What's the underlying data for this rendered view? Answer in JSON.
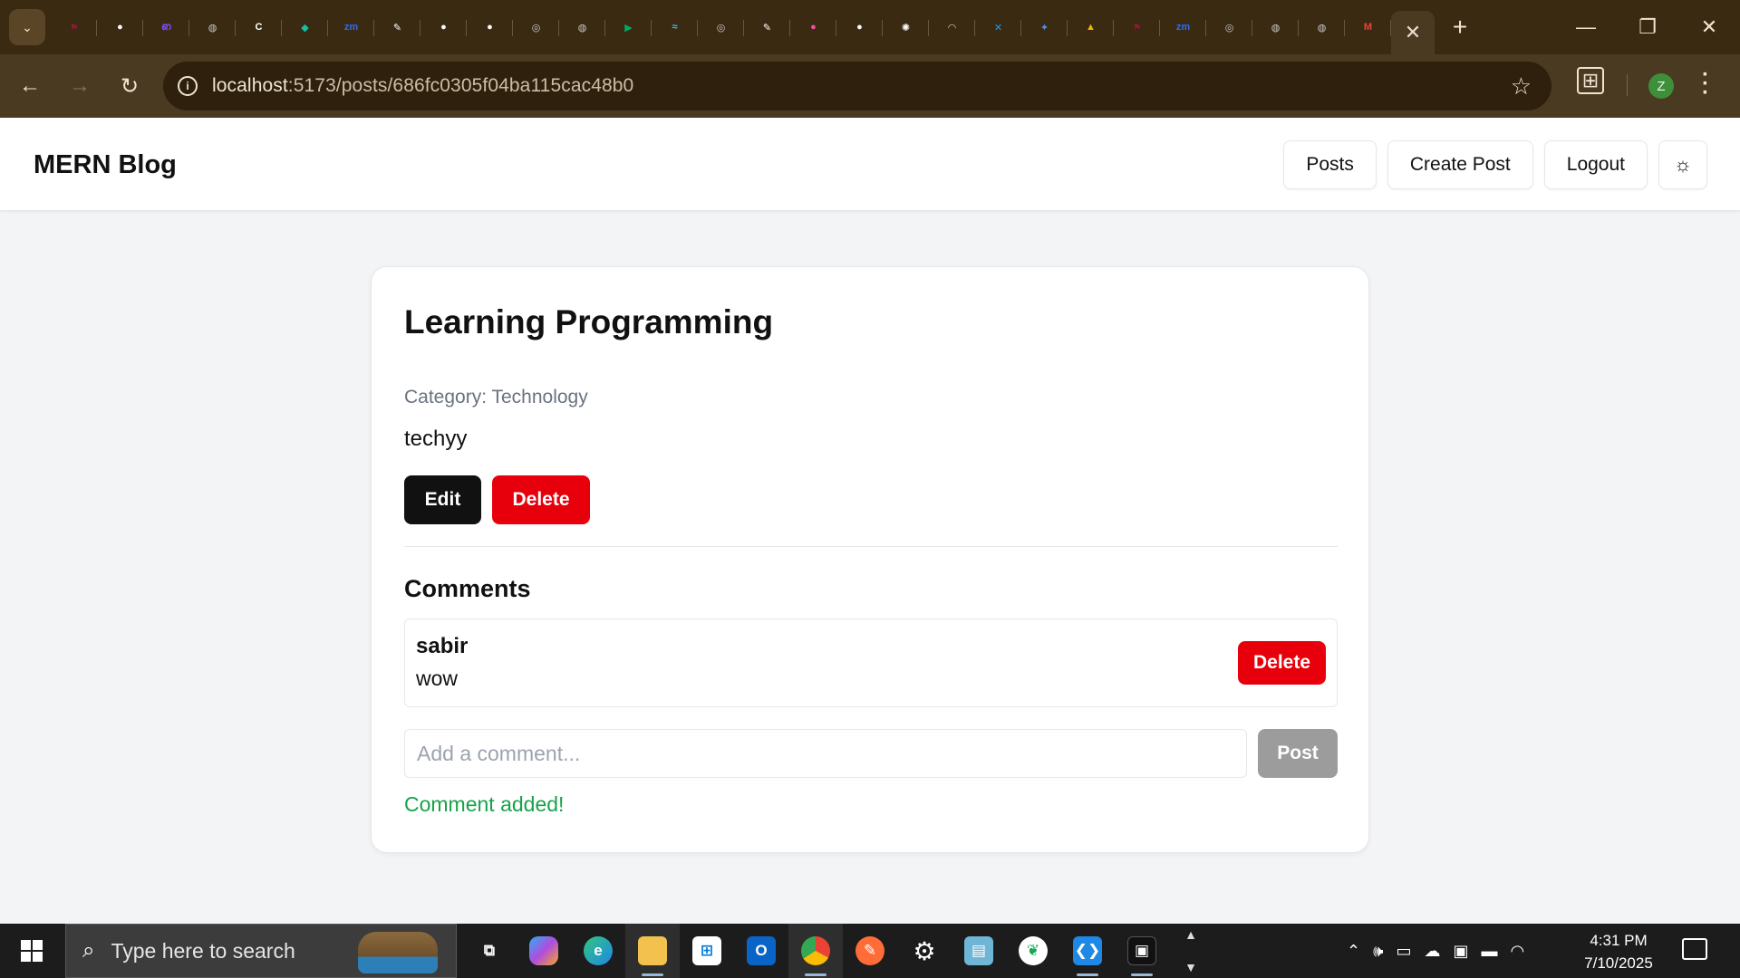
{
  "browser": {
    "tabs": [
      {
        "icon": "flag-icon",
        "color": "#8b1a3a",
        "glyph": "⚑"
      },
      {
        "icon": "github-icon",
        "color": "#ffffff",
        "glyph": "●"
      },
      {
        "icon": "octopus-icon",
        "color": "#7c4dff",
        "glyph": "ഩ"
      },
      {
        "icon": "globe-icon",
        "color": "#c9c9c9",
        "glyph": "◍"
      },
      {
        "icon": "codegen-icon",
        "color": "#ffffff",
        "glyph": "C"
      },
      {
        "icon": "android-studio-icon",
        "color": "#16c0a0",
        "glyph": "◆"
      },
      {
        "icon": "zoom-icon",
        "color": "#2d6cf6",
        "glyph": "zm"
      },
      {
        "icon": "notion-pen-icon",
        "color": "#ffffff",
        "glyph": "✎"
      },
      {
        "icon": "github-icon",
        "color": "#ffffff",
        "glyph": "●"
      },
      {
        "icon": "github-icon",
        "color": "#ffffff",
        "glyph": "●"
      },
      {
        "icon": "chrome-icon",
        "color": "#c9c9c9",
        "glyph": "◎"
      },
      {
        "icon": "globe-icon",
        "color": "#c9c9c9",
        "glyph": "◍"
      },
      {
        "icon": "google-meet-icon",
        "color": "#00a862",
        "glyph": "▶"
      },
      {
        "icon": "tailwind-icon",
        "color": "#38bdf8",
        "glyph": "≈"
      },
      {
        "icon": "chrome-icon",
        "color": "#c9c9c9",
        "glyph": "◎"
      },
      {
        "icon": "notion-pen-icon",
        "color": "#ffffff",
        "glyph": "✎"
      },
      {
        "icon": "colorful-blob-icon",
        "color": "#f050a0",
        "glyph": "●"
      },
      {
        "icon": "github-icon",
        "color": "#ffffff",
        "glyph": "●"
      },
      {
        "icon": "openai-icon",
        "color": "#ffffff",
        "glyph": "✺"
      },
      {
        "icon": "rss-icon",
        "color": "#c9c9c9",
        "glyph": "◠"
      },
      {
        "icon": "x-icon",
        "color": "#1d9bf0",
        "glyph": "✕"
      },
      {
        "icon": "sparkle-icon",
        "color": "#4e8ef7",
        "glyph": "✦"
      },
      {
        "icon": "google-drive-icon",
        "color": "#f4b400",
        "glyph": "▲"
      },
      {
        "icon": "flag-icon",
        "color": "#8b1a3a",
        "glyph": "⚑"
      },
      {
        "icon": "zoom-icon",
        "color": "#2d6cf6",
        "glyph": "zm"
      },
      {
        "icon": "chrome-icon",
        "color": "#c9c9c9",
        "glyph": "◎"
      },
      {
        "icon": "globe-icon",
        "color": "#c9c9c9",
        "glyph": "◍"
      },
      {
        "icon": "globe-icon",
        "color": "#c9c9c9",
        "glyph": "◍"
      },
      {
        "icon": "gmail-icon",
        "color": "#ea4335",
        "glyph": "M"
      }
    ],
    "url_host": "localhost",
    "url_path": ":5173/posts/686fc0305f04ba115cac48b0"
  },
  "nav": {
    "brand": "MERN Blog",
    "posts": "Posts",
    "create_post": "Create Post",
    "logout": "Logout",
    "theme_icon": "☼"
  },
  "post": {
    "title": "Learning Programming",
    "category": "Category: Technology",
    "content": "techyy",
    "edit": "Edit",
    "delete": "Delete"
  },
  "comments": {
    "heading": "Comments",
    "items": [
      {
        "author": "sabir",
        "text": "wow",
        "delete": "Delete"
      }
    ],
    "input_placeholder": "Add a comment...",
    "post_button": "Post",
    "success": "Comment added!"
  },
  "taskbar": {
    "search_placeholder": "Type here to search",
    "time": "4:31 PM",
    "date": "7/10/2025"
  },
  "colors": {
    "danger": "#e7000b",
    "success": "#16a34a",
    "primary": "#111111",
    "disabled": "#9c9c9c"
  }
}
